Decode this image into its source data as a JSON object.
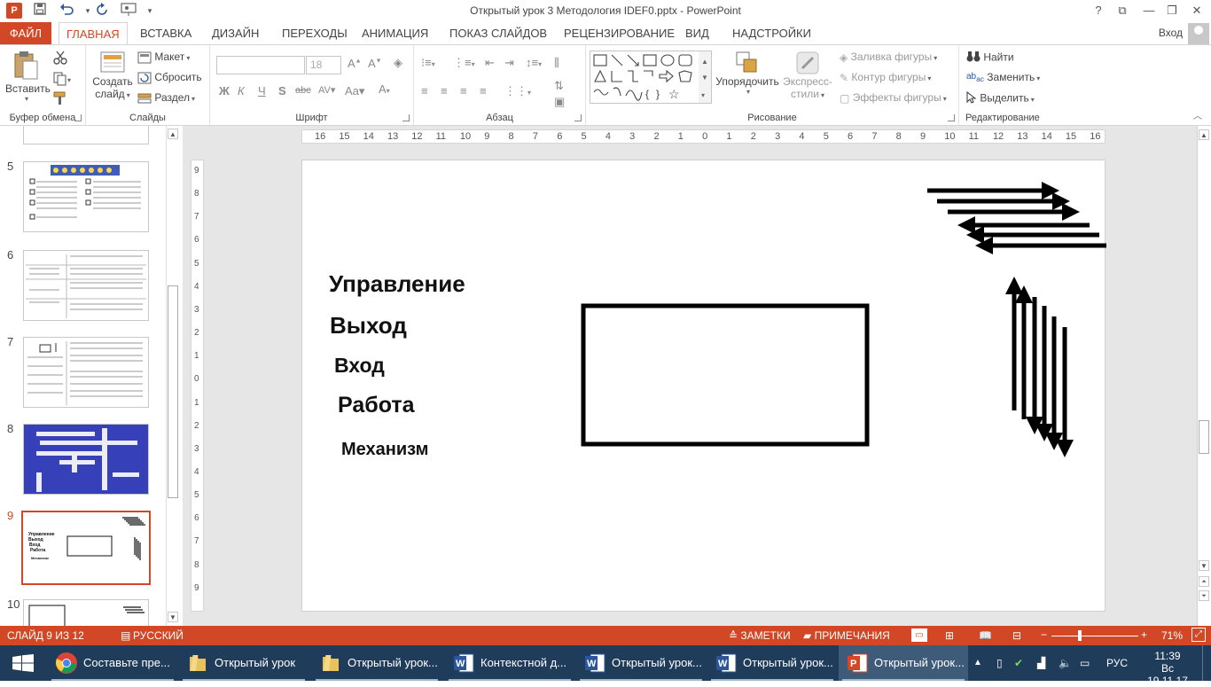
{
  "app": {
    "title": "Открытый урок 3 Методология IDEF0.pptx - PowerPoint",
    "logo": "P"
  },
  "quick_access": [
    {
      "name": "save-icon",
      "glyph": "💾"
    },
    {
      "name": "undo-icon",
      "glyph": "↶"
    },
    {
      "name": "redo-icon",
      "glyph": "↻"
    },
    {
      "name": "presentation-icon",
      "glyph": "⊡"
    },
    {
      "name": "customize-icon",
      "glyph": "▾"
    }
  ],
  "window_controls": {
    "help": "?",
    "ribbon_display": "⧉",
    "minimize": "—",
    "restore": "❐",
    "close": "✕"
  },
  "tabs": {
    "file": "ФАЙЛ",
    "items": [
      "ГЛАВНАЯ",
      "ВСТАВКА",
      "ДИЗАЙН",
      "ПЕРЕХОДЫ",
      "АНИМАЦИЯ",
      "ПОКАЗ СЛАЙДОВ",
      "РЕЦЕНЗИРОВАНИЕ",
      "ВИД",
      "НАДСТРОЙКИ"
    ],
    "active": "ГЛАВНАЯ",
    "signin": "Вход"
  },
  "ribbon": {
    "clipboard": {
      "title": "Буфер обмена",
      "paste": "Вставить"
    },
    "slides": {
      "title": "Слайды",
      "new_slide_1": "Создать",
      "new_slide_2": "слайд",
      "layout": "Макет",
      "reset": "Сбросить",
      "section": "Раздел"
    },
    "font": {
      "title": "Шрифт",
      "font_name": "",
      "font_size": "18"
    },
    "paragraph": {
      "title": "Абзац"
    },
    "drawing": {
      "title": "Рисование",
      "arrange": "Упорядочить",
      "quick_styles_1": "Экспресс-",
      "quick_styles_2": "стили",
      "shape_fill": "Заливка фигуры",
      "shape_outline": "Контур фигуры",
      "shape_effects": "Эффекты фигуры"
    },
    "editing": {
      "title": "Редактирование",
      "find": "Найти",
      "replace": "Заменить",
      "select": "Выделить"
    }
  },
  "thumbnails": [
    {
      "num": "5"
    },
    {
      "num": "6"
    },
    {
      "num": "7"
    },
    {
      "num": "8"
    },
    {
      "num": "9",
      "selected": true
    },
    {
      "num": "10"
    }
  ],
  "thumb9": {
    "labels": [
      "Управление",
      "Выход",
      "Вход",
      "Работа",
      "Механизм"
    ]
  },
  "ruler": {
    "h_ticks": [
      "16",
      "15",
      "14",
      "13",
      "12",
      "11",
      "10",
      "9",
      "8",
      "7",
      "6",
      "5",
      "4",
      "3",
      "2",
      "1",
      "0",
      "1",
      "2",
      "3",
      "4",
      "5",
      "6",
      "7",
      "8",
      "9",
      "10",
      "11",
      "12",
      "13",
      "14",
      "15",
      "16"
    ],
    "v_ticks": [
      "9",
      "8",
      "7",
      "6",
      "5",
      "4",
      "3",
      "2",
      "1",
      "0",
      "1",
      "2",
      "3",
      "4",
      "5",
      "6",
      "7",
      "8",
      "9"
    ]
  },
  "slide": {
    "labels": {
      "control": "Управление",
      "output": "Выход",
      "input": "Вход",
      "work": "Работа",
      "mechanism": "Механизм"
    }
  },
  "status": {
    "slide_info": "СЛАЙД 9 ИЗ 12",
    "language": "РУССКИЙ",
    "notes": "ЗАМЕТКИ",
    "comments": "ПРИМЕЧАНИЯ",
    "zoom": "71%"
  },
  "taskbar": {
    "items": [
      {
        "label": "Составьте пре...",
        "icon": "chrome"
      },
      {
        "label": "Открытый урок",
        "icon": "folder"
      },
      {
        "label": "Открытый урок...",
        "icon": "folder"
      },
      {
        "label": "Контекстной д...",
        "icon": "word"
      },
      {
        "label": "Открытый урок...",
        "icon": "word"
      },
      {
        "label": "Открытый урок...",
        "icon": "word"
      },
      {
        "label": "Открытый урок...",
        "icon": "powerpoint",
        "active": true
      }
    ],
    "lang": "РУС",
    "time": "11:39",
    "date": "Вс 19.11.17"
  },
  "colors": {
    "accent": "#d24726",
    "taskbar": "#1f3c5a",
    "editor_bg": "#e6e6e6"
  }
}
